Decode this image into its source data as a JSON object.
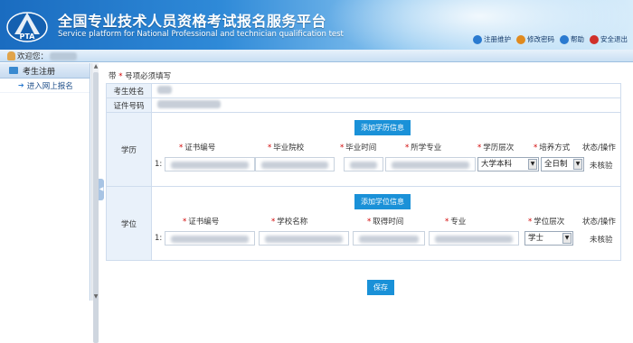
{
  "header": {
    "title_cn": "全国专业技术人员资格考试报名服务平台",
    "title_en": "Service platform for National Professional and technician qualification test",
    "logo_text": "PTA",
    "links": [
      {
        "label": "注册维护",
        "icon": "user-edit-icon",
        "color": "#2a7ad0"
      },
      {
        "label": "修改密码",
        "icon": "key-icon",
        "color": "#e08a1e"
      },
      {
        "label": "帮助",
        "icon": "help-icon",
        "color": "#2a7ad0"
      },
      {
        "label": "安全退出",
        "icon": "power-icon",
        "color": "#d0302a"
      }
    ]
  },
  "welcome": "欢迎您：",
  "sidebar": {
    "section": "考生注册",
    "items": [
      {
        "label": "进入网上报名"
      }
    ]
  },
  "form": {
    "required_note_prefix": "带",
    "required_note_star": "*",
    "required_note_suffix": "号项必须填写",
    "name_label": "考生姓名",
    "id_label": "证件号码",
    "education": {
      "label": "学历",
      "add_button": "添加学历信息",
      "columns": [
        {
          "label": "证书编号",
          "required": true
        },
        {
          "label": "毕业院校",
          "required": true
        },
        {
          "label": "毕业时间",
          "required": true
        },
        {
          "label": "所学专业",
          "required": true
        },
        {
          "label": "学历层次",
          "required": true
        },
        {
          "label": "培养方式",
          "required": true
        },
        {
          "label": "状态/操作",
          "required": false
        }
      ],
      "row_index": "1:",
      "level_value": "大学本科",
      "mode_value": "全日制",
      "status": "未核验"
    },
    "degree": {
      "label": "学位",
      "add_button": "添加学位信息",
      "columns": [
        {
          "label": "证书编号",
          "required": true
        },
        {
          "label": "学校名称",
          "required": true
        },
        {
          "label": "取得时间",
          "required": true
        },
        {
          "label": "专业",
          "required": true
        },
        {
          "label": "学位层次",
          "required": true
        },
        {
          "label": "状态/操作",
          "required": false
        }
      ],
      "row_index": "1:",
      "level_value": "学士",
      "status": "未核验"
    },
    "save_button": "保存"
  }
}
